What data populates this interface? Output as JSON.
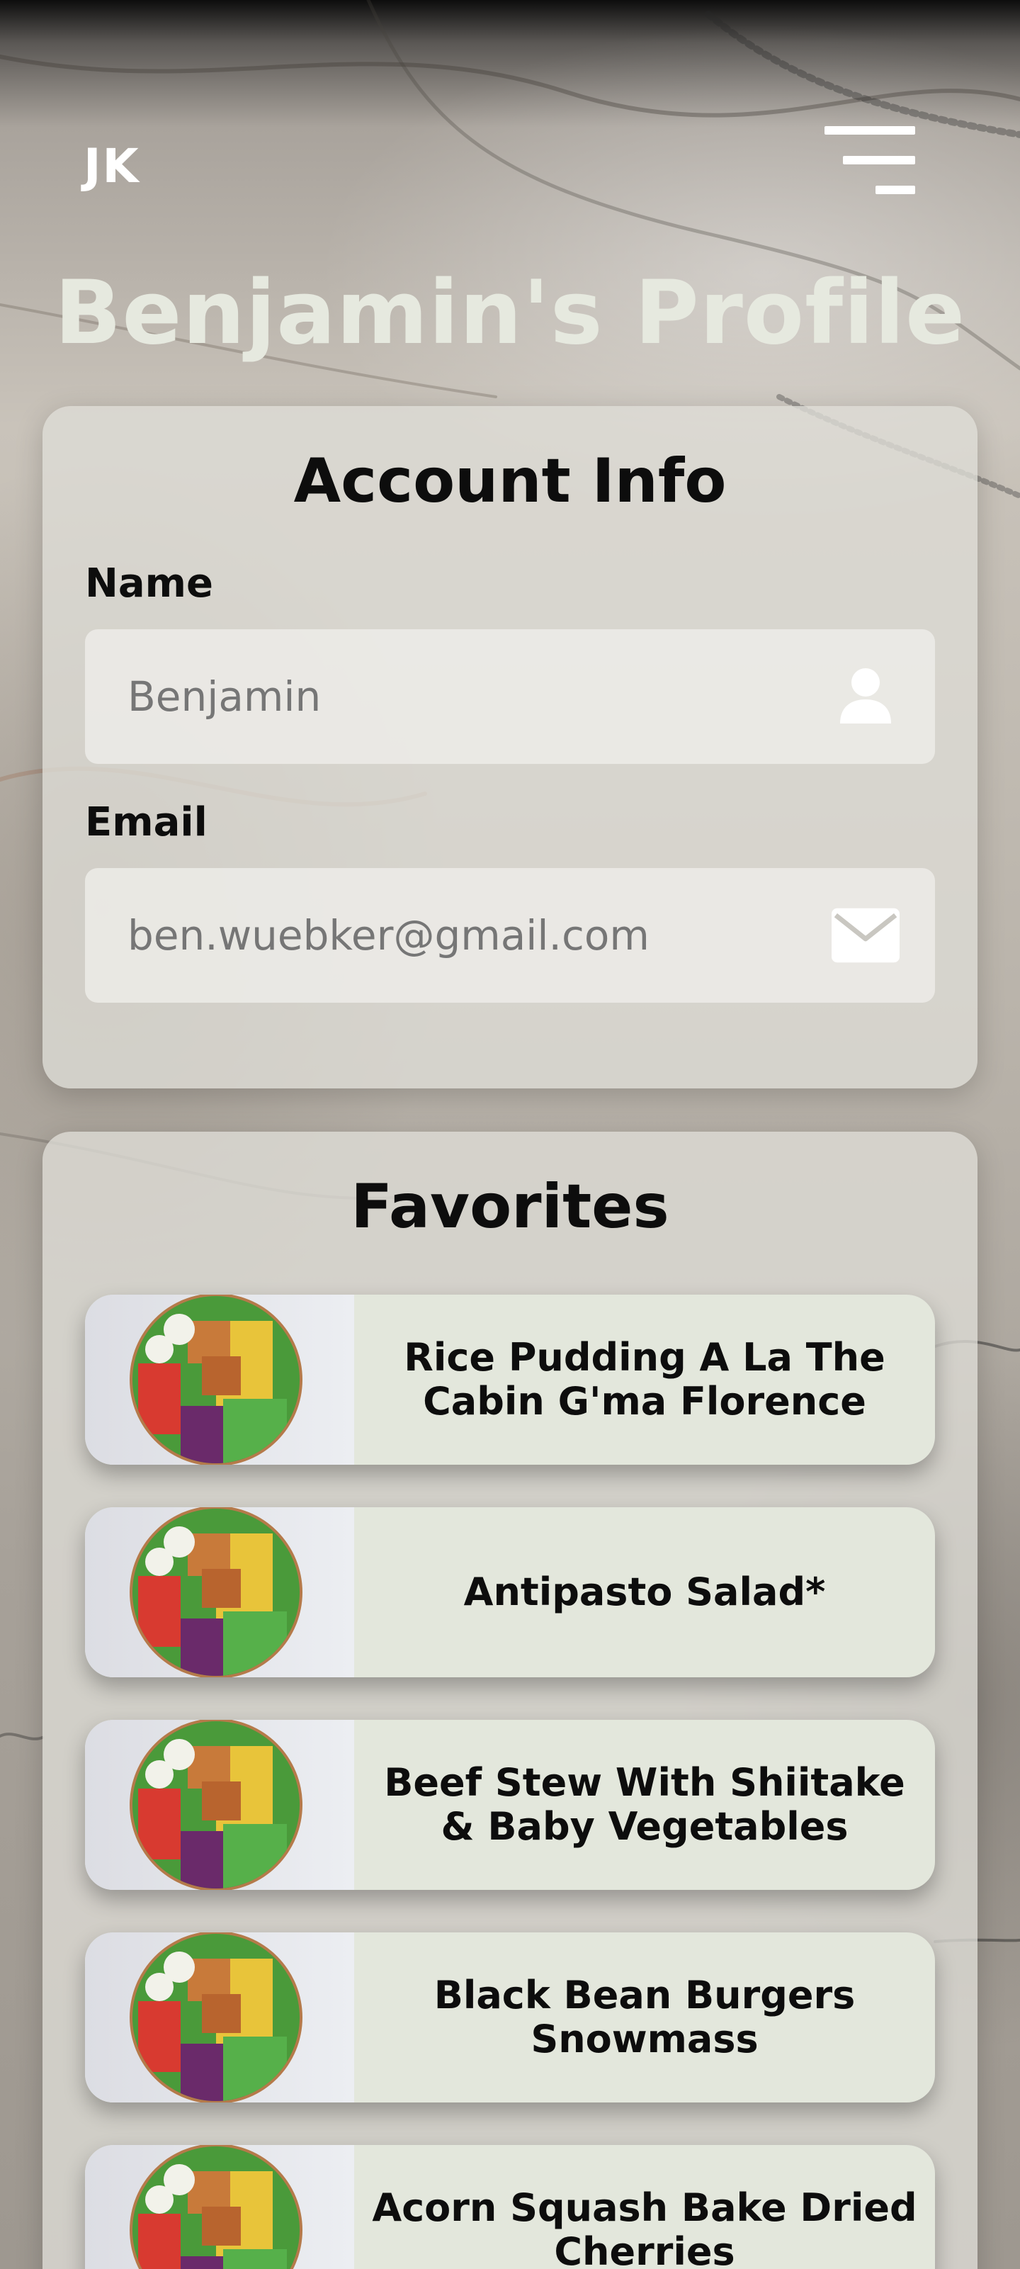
{
  "header": {
    "logo_text": "JK",
    "menu_icon": "hamburger-menu-icon"
  },
  "page_title": "Benjamin's Profile",
  "account": {
    "title": "Account Info",
    "name": {
      "label": "Name",
      "placeholder": "Benjamin",
      "value": "",
      "icon": "user-icon"
    },
    "email": {
      "label": "Email",
      "placeholder": "ben.wuebker@gmail.com",
      "value": "",
      "icon": "envelope-icon"
    }
  },
  "favorites": {
    "title": "Favorites",
    "items": [
      {
        "name": "Rice Pudding A La The Cabin G'ma Florence",
        "image_icon": "salad-bowl-image"
      },
      {
        "name": "Antipasto Salad*",
        "image_icon": "salad-bowl-image"
      },
      {
        "name": "Beef Stew With Shiitake & Baby Vegetables",
        "image_icon": "salad-bowl-image"
      },
      {
        "name": "Black Bean Burgers Snowmass",
        "image_icon": "salad-bowl-image"
      },
      {
        "name": "Acorn Squash Bake Dried Cherries",
        "image_icon": "salad-bowl-image"
      }
    ]
  },
  "colors": {
    "title_text": "#e6e9df",
    "card_bg": "#dedcd6",
    "fav_item_bg": "#e3e7dc",
    "placeholder_text": "#767676"
  }
}
